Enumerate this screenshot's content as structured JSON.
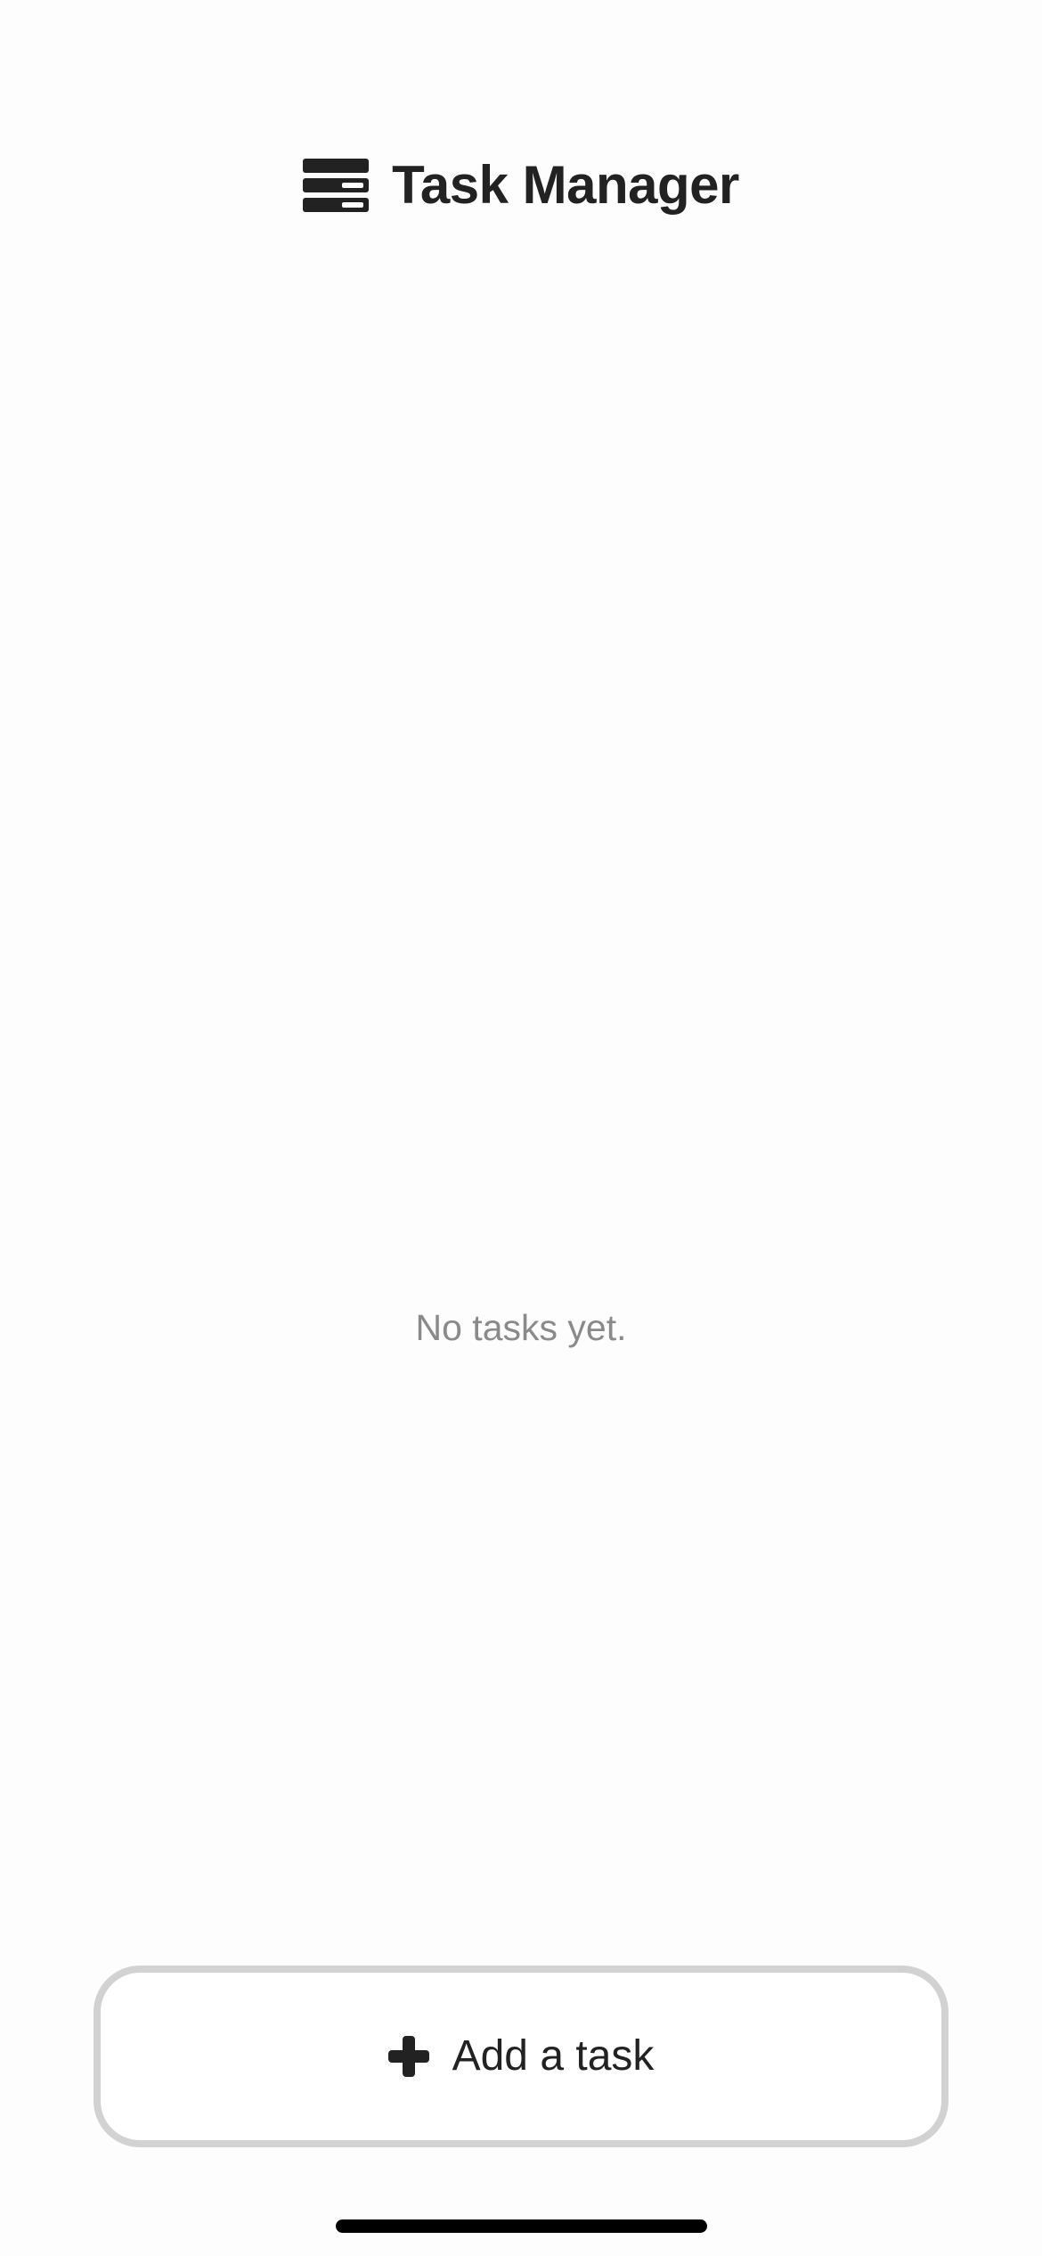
{
  "header": {
    "icon": "task-list-icon",
    "title": "Task Manager"
  },
  "task_list": {
    "tasks": [],
    "empty_message": "No tasks yet."
  },
  "add_task_button": {
    "icon": "plus-icon",
    "label": "Add a task"
  },
  "colors": {
    "background": "#fdfdfd",
    "text_primary": "#222222",
    "text_muted": "#8a8a8a",
    "button_border": "#d2d2d2"
  }
}
